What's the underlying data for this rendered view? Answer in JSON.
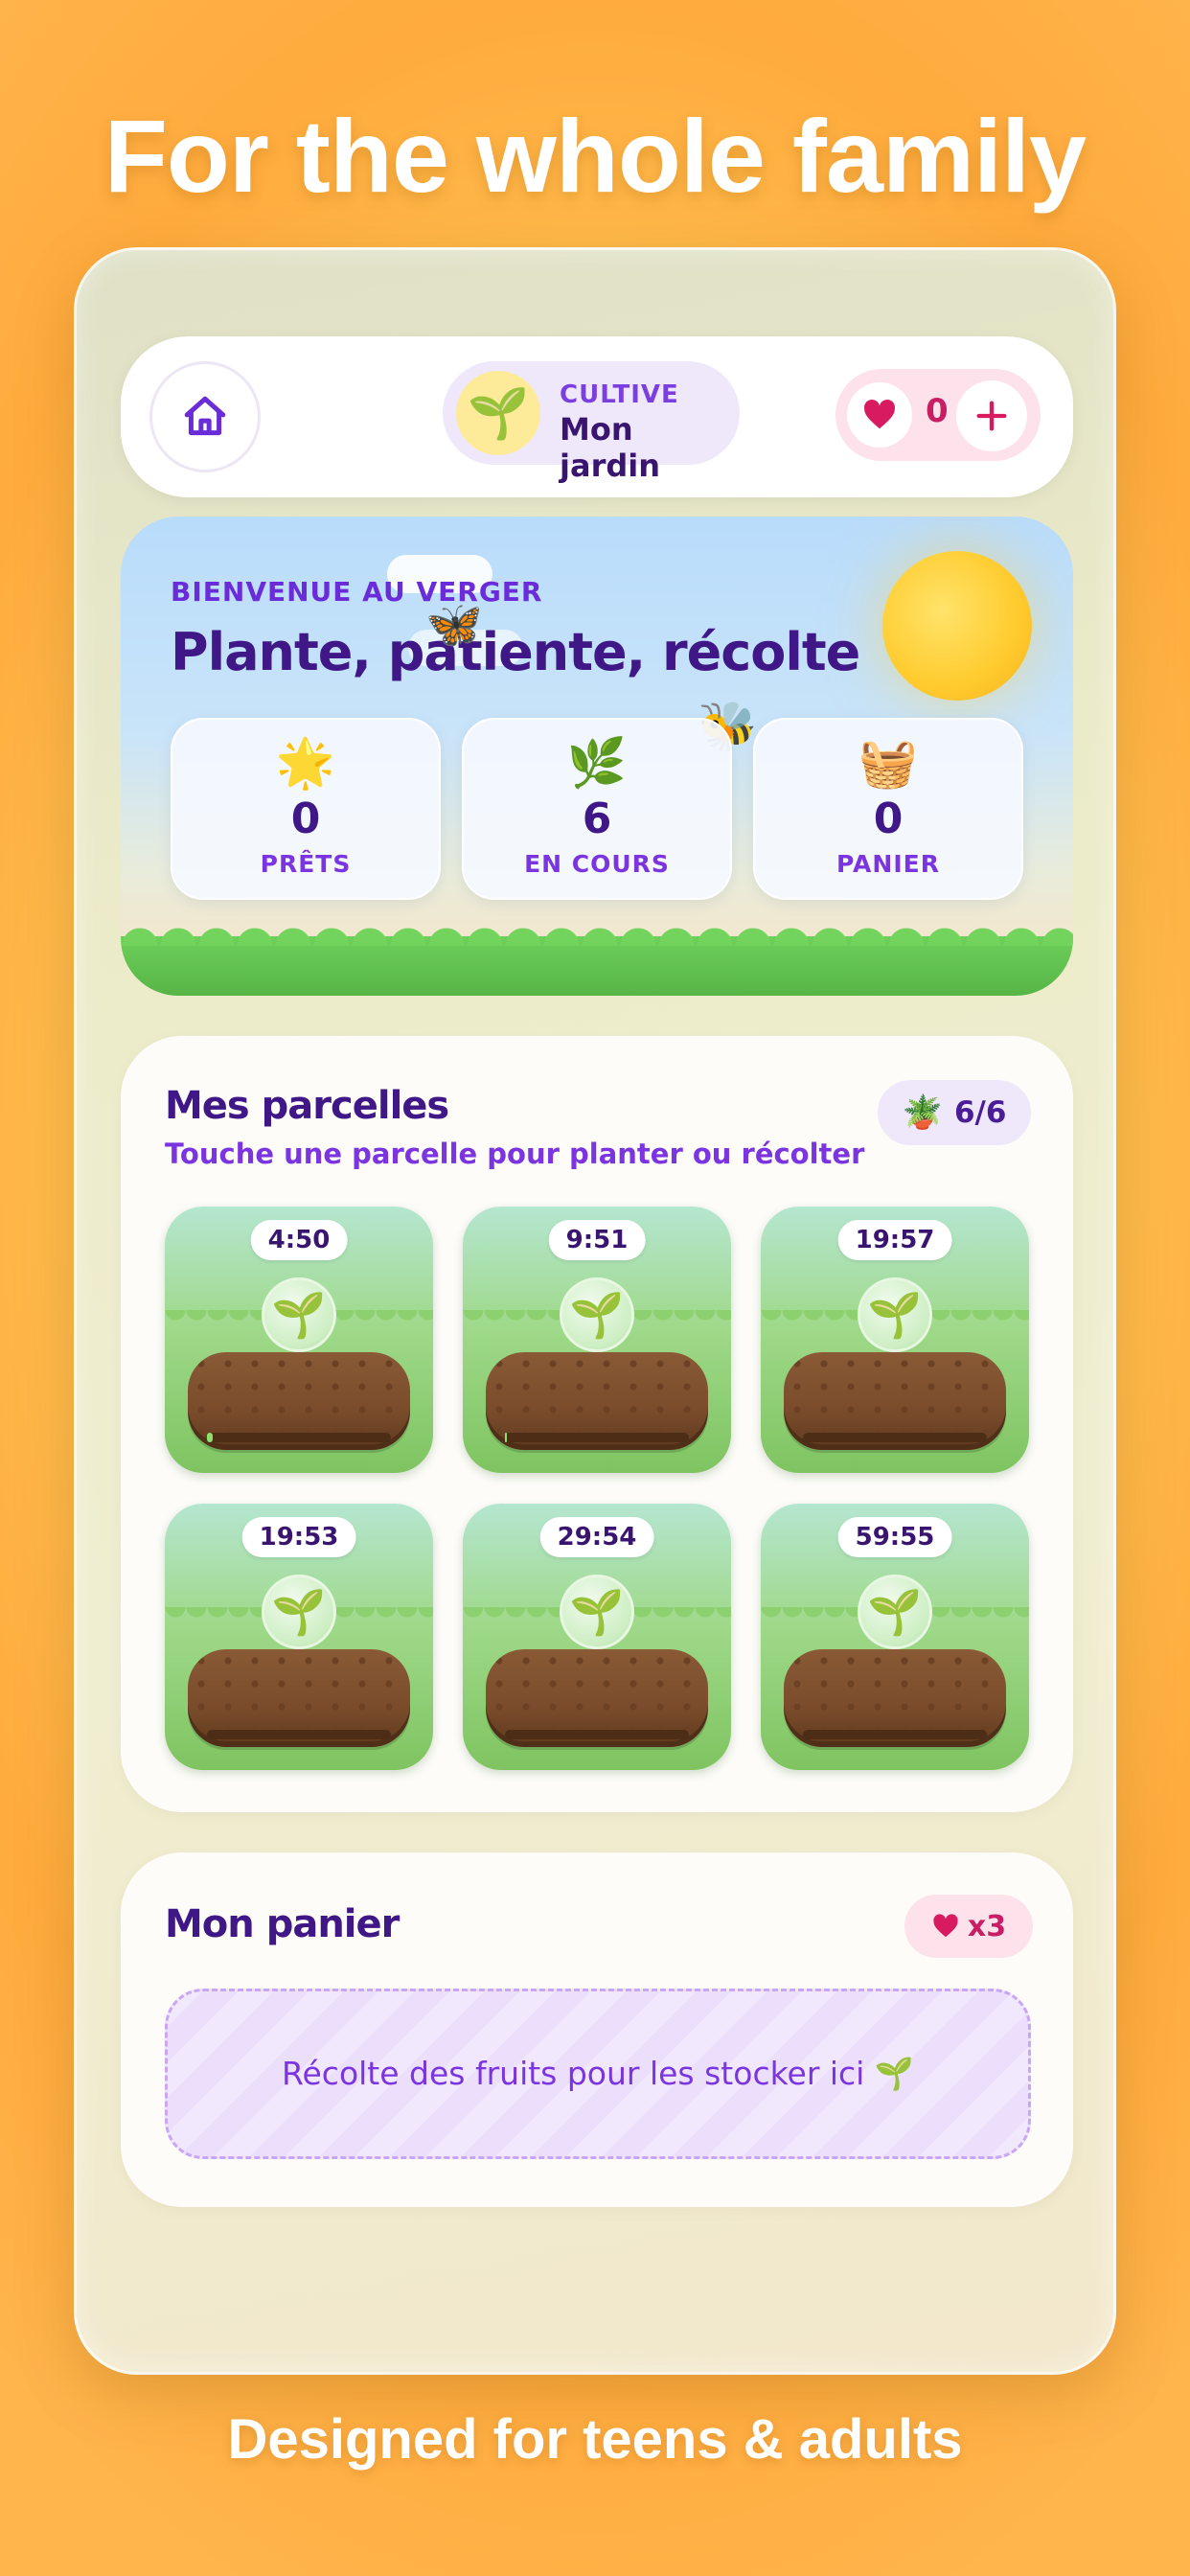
{
  "marketing": {
    "headline": "For the whole family",
    "footline": "Designed for teens & adults"
  },
  "topbar": {
    "home_icon": "home-icon",
    "cultive_label": "CULTIVE",
    "garden_name": "Mon jardin",
    "avatar_glyph": "🌱",
    "hearts_count": "0",
    "plus_icon": "plus-icon"
  },
  "hero": {
    "kicker": "BIENVENUE AU VERGER",
    "title": "Plante, patiente, récolte",
    "butterfly": "🦋",
    "bee": "🐝",
    "stats": [
      {
        "icon": "🌟",
        "value": "0",
        "label": "PRÊTS"
      },
      {
        "icon": "🌿",
        "value": "6",
        "label": "EN COURS"
      },
      {
        "icon": "🧺",
        "value": "0",
        "label": "PANIER"
      }
    ]
  },
  "parcels": {
    "title": "Mes parcelles",
    "subtitle": "Touche une parcelle pour planter ou récolter",
    "badge_icon": "🪴",
    "badge_count": "6/6",
    "plots": [
      {
        "timer": "4:50",
        "sprout": "🌱",
        "progress": 0.03
      },
      {
        "timer": "9:51",
        "sprout": "🌱",
        "progress": 0.01
      },
      {
        "timer": "19:57",
        "sprout": "🌱",
        "progress": 0.0
      },
      {
        "timer": "19:53",
        "sprout": "🌱",
        "progress": 0.0
      },
      {
        "timer": "29:54",
        "sprout": "🌱",
        "progress": 0.0
      },
      {
        "timer": "59:55",
        "sprout": "🌱",
        "progress": 0.0
      }
    ]
  },
  "basket": {
    "title": "Mon panier",
    "lives": "x3",
    "empty_text": "Récolte des fruits pour les stocker ici 🌱"
  },
  "colors": {
    "accent_purple": "#7a34e0",
    "title_purple": "#3f1787",
    "heart_pink": "#d81b60"
  }
}
